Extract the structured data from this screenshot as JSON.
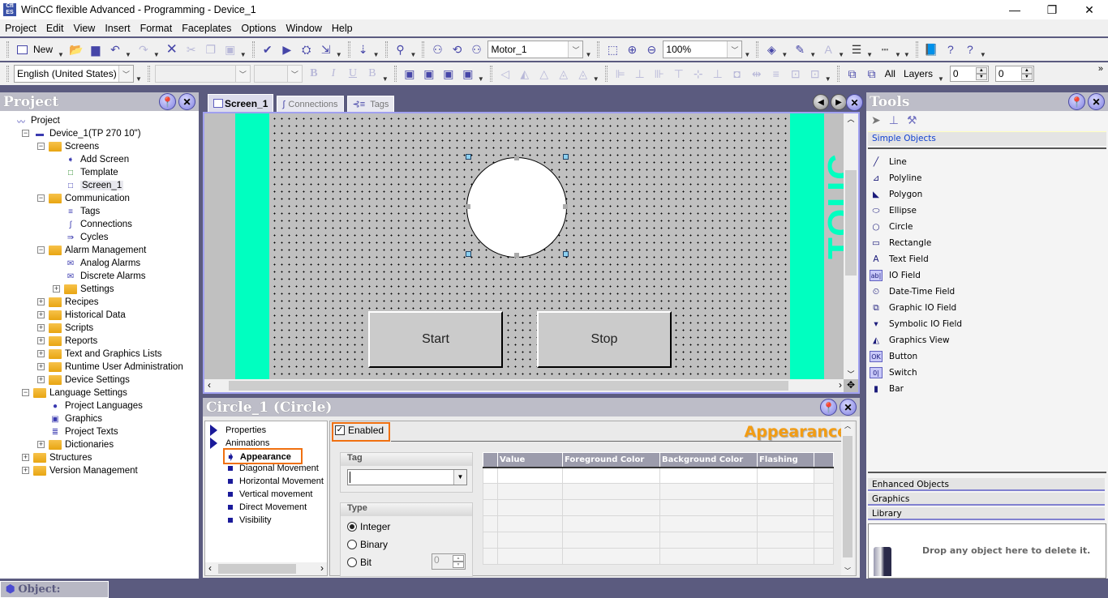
{
  "window": {
    "title": "WinCC flexible Advanced - Programming - Device_1",
    "app_icon": "wincc-icon",
    "controls": {
      "minimize": "—",
      "restore": "❐",
      "close": "✕"
    }
  },
  "menu": [
    {
      "label": "Project"
    },
    {
      "label": "Edit"
    },
    {
      "label": "View"
    },
    {
      "label": "Insert"
    },
    {
      "label": "Format"
    },
    {
      "label": "Faceplates"
    },
    {
      "label": "Options"
    },
    {
      "label": "Window"
    },
    {
      "label": "Help"
    }
  ],
  "toolbar1": {
    "new_label": "New",
    "object_combo": "Motor_1",
    "zoom_combo": "100%"
  },
  "toolbar2": {
    "language_combo": "English (United States)",
    "font_combo": "",
    "size_combo": "",
    "layers_all": "All",
    "layers_label": "Layers",
    "layer_spin1": "0",
    "layer_spin2": "0",
    "overflow": "»"
  },
  "project_panel": {
    "title": "Project",
    "tree": [
      {
        "label": "Project",
        "icon": "project-icon",
        "level": 0
      },
      {
        "label": "Device_1(TP 270 10\")",
        "icon": "device-icon",
        "level": 1,
        "expanded": true
      },
      {
        "label": "Screens",
        "icon": "folder-icon",
        "level": 2,
        "expanded": true
      },
      {
        "label": "Add Screen",
        "icon": "add-screen-icon",
        "level": 3
      },
      {
        "label": "Template",
        "icon": "template-icon",
        "level": 3
      },
      {
        "label": "Screen_1",
        "icon": "screen-icon",
        "level": 3,
        "selected": true
      },
      {
        "label": "Communication",
        "icon": "folder-icon",
        "level": 2,
        "expanded": true
      },
      {
        "label": "Tags",
        "icon": "tags-icon",
        "level": 3
      },
      {
        "label": "Connections",
        "icon": "connections-icon",
        "level": 3
      },
      {
        "label": "Cycles",
        "icon": "cycles-icon",
        "level": 3
      },
      {
        "label": "Alarm Management",
        "icon": "folder-icon",
        "level": 2,
        "expanded": true
      },
      {
        "label": "Analog Alarms",
        "icon": "analog-alarm-icon",
        "level": 3
      },
      {
        "label": "Discrete Alarms",
        "icon": "discrete-alarm-icon",
        "level": 3
      },
      {
        "label": "Settings",
        "icon": "folder-icon",
        "level": 3,
        "expanded": false
      },
      {
        "label": "Recipes",
        "icon": "folder-icon",
        "level": 2,
        "expanded": false
      },
      {
        "label": "Historical Data",
        "icon": "folder-icon",
        "level": 2,
        "expanded": false
      },
      {
        "label": "Scripts",
        "icon": "folder-icon",
        "level": 2,
        "expanded": false
      },
      {
        "label": "Reports",
        "icon": "folder-icon",
        "level": 2,
        "expanded": false
      },
      {
        "label": "Text and Graphics Lists",
        "icon": "folder-icon",
        "level": 2,
        "expanded": false
      },
      {
        "label": "Runtime User Administration",
        "icon": "folder-icon",
        "level": 2,
        "expanded": false
      },
      {
        "label": "Device Settings",
        "icon": "folder-icon",
        "level": 2,
        "expanded": false
      },
      {
        "label": "Language Settings",
        "icon": "folder-icon",
        "level": 1,
        "expanded": true
      },
      {
        "label": "Project Languages",
        "icon": "globe-icon",
        "level": 2
      },
      {
        "label": "Graphics",
        "icon": "graphics-icon",
        "level": 2
      },
      {
        "label": "Project Texts",
        "icon": "texts-icon",
        "level": 2
      },
      {
        "label": "Dictionaries",
        "icon": "folder-icon",
        "level": 2,
        "expanded": false
      },
      {
        "label": "Structures",
        "icon": "folder-icon",
        "level": 1,
        "expanded": false
      },
      {
        "label": "Version Management",
        "icon": "folder-icon",
        "level": 1,
        "expanded": false
      }
    ]
  },
  "editor": {
    "tabs": [
      {
        "label": "Screen_1",
        "active": true
      },
      {
        "label": "Connections",
        "active": false
      },
      {
        "label": "Tags",
        "active": false
      }
    ],
    "canvas": {
      "accent_color": "#00ffc0",
      "side_text": "TOUC",
      "buttons": [
        {
          "label": "Start"
        },
        {
          "label": "Stop"
        }
      ],
      "selected_object": "Circle_1"
    }
  },
  "properties": {
    "title": "Circle_1 (Circle)",
    "nav": [
      {
        "label": "Properties",
        "kind": "group"
      },
      {
        "label": "Animations",
        "kind": "group"
      },
      {
        "label": "Appearance",
        "kind": "item",
        "selected": true
      },
      {
        "label": "Diagonal Movement",
        "kind": "item"
      },
      {
        "label": "Horizontal Movement",
        "kind": "item"
      },
      {
        "label": "Vertical movement",
        "kind": "item"
      },
      {
        "label": "Direct Movement",
        "kind": "item"
      },
      {
        "label": "Visibility",
        "kind": "item"
      }
    ],
    "enabled_label": "Enabled",
    "enabled_checked": true,
    "section_title": "Appearance",
    "tag_group": "Tag",
    "tag_value": "",
    "type_group": "Type",
    "type_options": [
      {
        "label": "Integer",
        "checked": true
      },
      {
        "label": "Binary",
        "checked": false
      },
      {
        "label": "Bit",
        "checked": false
      }
    ],
    "bit_value": "0",
    "table_headers": [
      "",
      "Value",
      "Foreground Color",
      "Background Color",
      "Flashing",
      ""
    ],
    "highlight_color": "#f07010"
  },
  "tools": {
    "title": "Tools",
    "category_open": "Simple Objects",
    "items": [
      {
        "label": "Line",
        "icon": "line-icon"
      },
      {
        "label": "Polyline",
        "icon": "polyline-icon"
      },
      {
        "label": "Polygon",
        "icon": "polygon-icon"
      },
      {
        "label": "Ellipse",
        "icon": "ellipse-icon"
      },
      {
        "label": "Circle",
        "icon": "circle-icon"
      },
      {
        "label": "Rectangle",
        "icon": "rectangle-icon"
      },
      {
        "label": "Text Field",
        "icon": "text-field-icon"
      },
      {
        "label": "IO Field",
        "icon": "io-field-icon"
      },
      {
        "label": "Date-Time Field",
        "icon": "date-time-icon"
      },
      {
        "label": "Graphic IO Field",
        "icon": "graphic-io-icon"
      },
      {
        "label": "Symbolic IO Field",
        "icon": "symbolic-io-icon"
      },
      {
        "label": "Graphics View",
        "icon": "graphics-view-icon"
      },
      {
        "label": "Button",
        "icon": "button-icon"
      },
      {
        "label": "Switch",
        "icon": "switch-icon"
      },
      {
        "label": "Bar",
        "icon": "bar-icon"
      }
    ],
    "categories_closed": [
      "Enhanced Objects",
      "Graphics",
      "Library"
    ],
    "trash_text": "Drop any object here to delete it."
  },
  "status": {
    "label": "Object:"
  }
}
